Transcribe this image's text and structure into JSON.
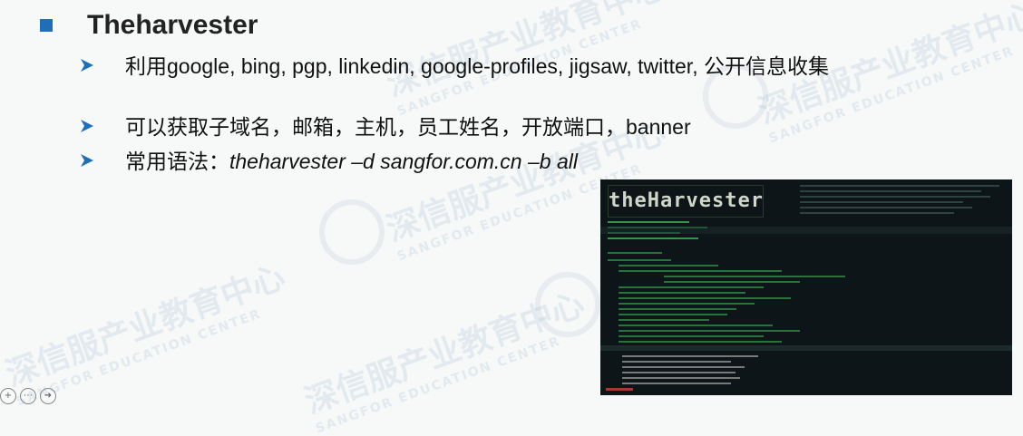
{
  "slide": {
    "title": "Theharvester",
    "bullets": [
      {
        "text": "利用google, bing, pgp, linkedin, google-profiles, jigsaw, twitter, 公开信息收集"
      },
      {
        "text": "可以获取子域名，邮箱，主机，员工姓名，开放端口，banner"
      },
      {
        "prefix": "常用语法：",
        "italic": "theharvester –d sangfor.com.cn –b all"
      }
    ]
  },
  "watermark": {
    "cn": "深信服产业教育中心",
    "en": "SANGFOR EDUCATION CENTER"
  },
  "terminal": {
    "logo": "theHarvester"
  },
  "colors": {
    "accent": "#1f6fb8",
    "terminal_bg": "#0e1518",
    "terminal_green": "#3fbf5a"
  }
}
